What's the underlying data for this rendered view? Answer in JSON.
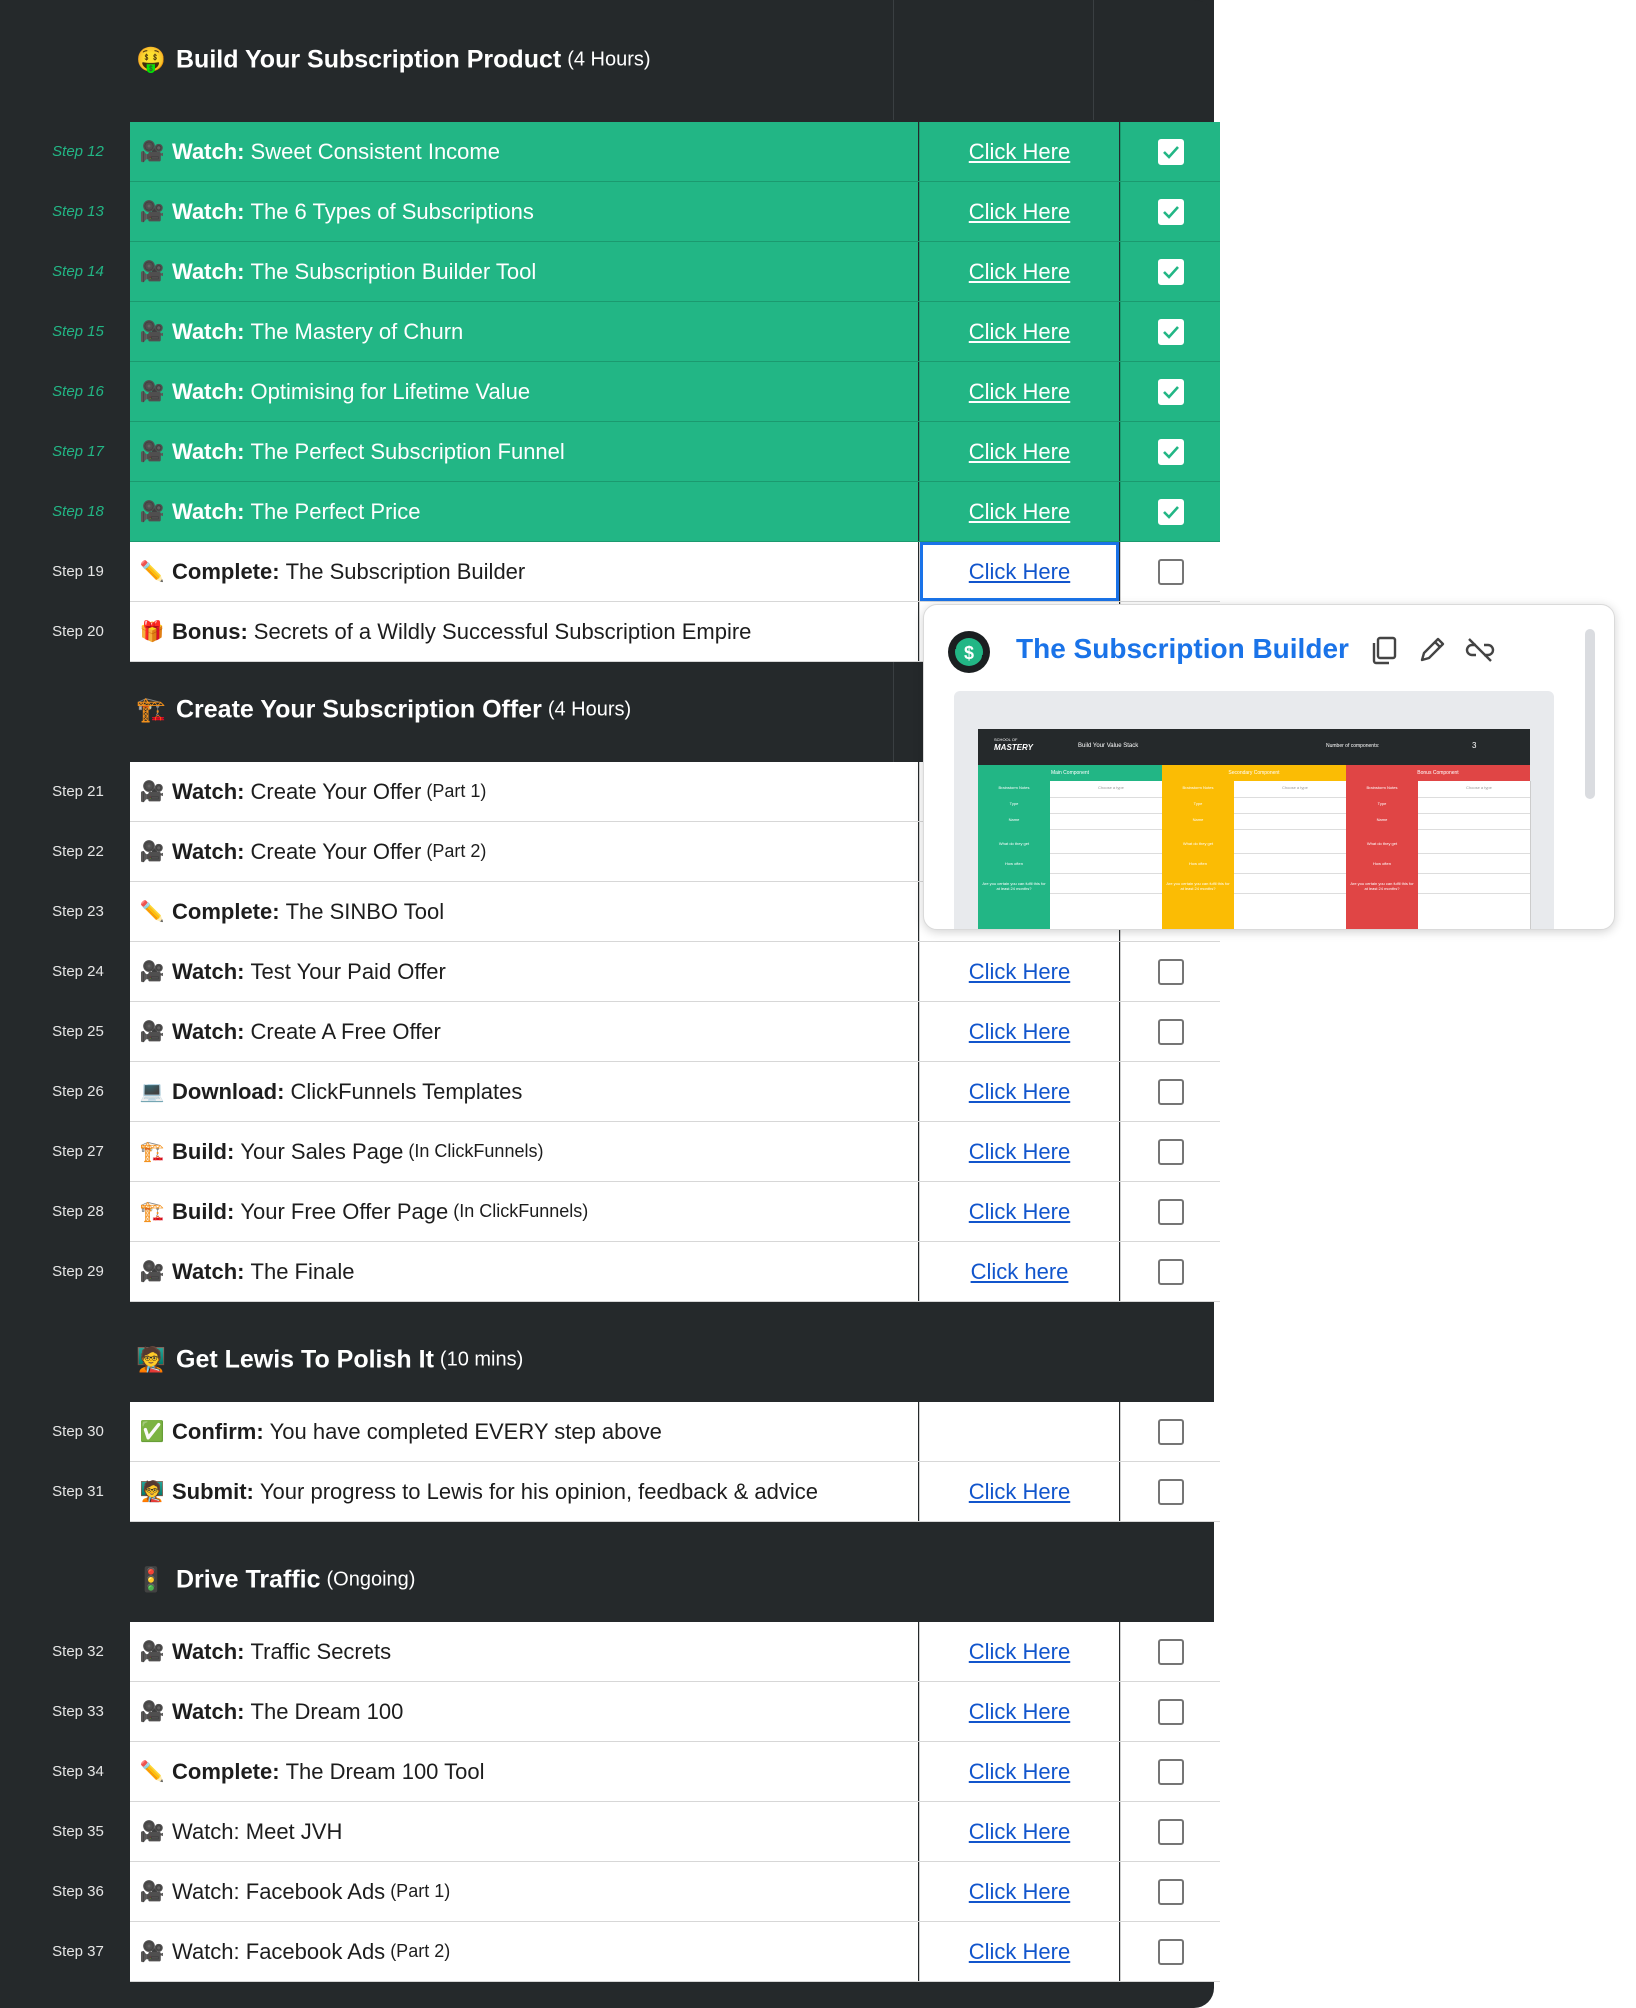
{
  "colors": {
    "dark": "#25292b",
    "done_green": "#22b685",
    "link_blue": "#1155cc",
    "popup_title_blue": "#1a73e8",
    "thumb_green": "#22b685",
    "thumb_yellow": "#fbbc04",
    "thumb_red": "#e04545"
  },
  "sections": [
    {
      "emoji": "🤑",
      "title": "Build Your Subscription Product",
      "sub": "(4 Hours)"
    },
    {
      "emoji": "🏗️",
      "title": "Create Your Subscription Offer",
      "sub": "(4 Hours)"
    },
    {
      "emoji": "🧑‍🏫",
      "title": "Get Lewis To Polish It",
      "sub": "(10 mins)"
    },
    {
      "emoji": "🚦",
      "title": "Drive Traffic",
      "sub": "(Ongoing)"
    }
  ],
  "rows": [
    {
      "step": "Step 12",
      "emoji": "🎥",
      "verb": "Watch:",
      "text": "Sweet Consistent Income",
      "small": "",
      "link": "Click Here",
      "checked": true
    },
    {
      "step": "Step 13",
      "emoji": "🎥",
      "verb": "Watch:",
      "text": "The 6 Types of Subscriptions",
      "small": "",
      "link": "Click Here",
      "checked": true
    },
    {
      "step": "Step 14",
      "emoji": "🎥",
      "verb": "Watch:",
      "text": "The Subscription Builder Tool",
      "small": "",
      "link": "Click Here",
      "checked": true
    },
    {
      "step": "Step 15",
      "emoji": "🎥",
      "verb": "Watch:",
      "text": "The Mastery of Churn",
      "small": "",
      "link": "Click Here",
      "checked": true
    },
    {
      "step": "Step 16",
      "emoji": "🎥",
      "verb": "Watch:",
      "text": "Optimising for Lifetime Value",
      "small": "",
      "link": "Click Here",
      "checked": true
    },
    {
      "step": "Step 17",
      "emoji": "🎥",
      "verb": "Watch:",
      "text": "The Perfect Subscription Funnel",
      "small": "",
      "link": "Click Here",
      "checked": true
    },
    {
      "step": "Step 18",
      "emoji": "🎥",
      "verb": "Watch:",
      "text": "The Perfect Price",
      "small": "",
      "link": "Click Here",
      "checked": true
    },
    {
      "step": "Step 19",
      "emoji": "✏️",
      "verb": "Complete:",
      "text": "The Subscription Builder",
      "small": "",
      "link": "Click Here",
      "checked": false
    },
    {
      "step": "Step 20",
      "emoji": "🎁",
      "verb": "Bonus:",
      "text": "Secrets of a Wildly Successful Subscription Empire",
      "small": "",
      "link": "",
      "checked": false
    },
    {
      "step": "Step 21",
      "emoji": "🎥",
      "verb": "Watch:",
      "text": "Create Your Offer",
      "small": "(Part 1)",
      "link": "",
      "checked": false
    },
    {
      "step": "Step 22",
      "emoji": "🎥",
      "verb": "Watch:",
      "text": "Create Your Offer",
      "small": "(Part 2)",
      "link": "",
      "checked": false
    },
    {
      "step": "Step 23",
      "emoji": "✏️",
      "verb": "Complete:",
      "text": "The SINBO Tool",
      "small": "",
      "link": "",
      "checked": false
    },
    {
      "step": "Step 24",
      "emoji": "🎥",
      "verb": "Watch:",
      "text": "Test Your Paid Offer",
      "small": "",
      "link": "Click Here",
      "checked": false
    },
    {
      "step": "Step 25",
      "emoji": "🎥",
      "verb": "Watch:",
      "text": "Create A Free Offer",
      "small": "",
      "link": "Click Here",
      "checked": false
    },
    {
      "step": "Step 26",
      "emoji": "💻",
      "verb": "Download:",
      "text": "ClickFunnels Templates",
      "small": "",
      "link": "Click Here",
      "checked": false
    },
    {
      "step": "Step 27",
      "emoji": "🏗️",
      "verb": "Build:",
      "text": "Your Sales Page",
      "small": "(In ClickFunnels)",
      "link": "Click Here",
      "checked": false
    },
    {
      "step": "Step 28",
      "emoji": "🏗️",
      "verb": "Build:",
      "text": "Your Free Offer Page",
      "small": "(In ClickFunnels)",
      "link": "Click Here",
      "checked": false
    },
    {
      "step": "Step 29",
      "emoji": "🎥",
      "verb": "Watch:",
      "text": "The Finale",
      "small": "",
      "link": "Click here",
      "checked": false
    },
    {
      "step": "Step 30",
      "emoji": "✅",
      "verb": "Confirm:",
      "text": "You have completed EVERY step above",
      "small": "",
      "link": "",
      "checked": false
    },
    {
      "step": "Step 31",
      "emoji": "🧑‍🏫",
      "verb": "Submit:",
      "text": "Your progress to Lewis for his opinion, feedback & advice",
      "small": "",
      "link": "Click Here",
      "checked": false
    },
    {
      "step": "Step 32",
      "emoji": "🎥",
      "verb": "Watch:",
      "text": "Traffic Secrets",
      "small": "",
      "link": "Click Here",
      "checked": false
    },
    {
      "step": "Step 33",
      "emoji": "🎥",
      "verb": "Watch:",
      "text": "The Dream 100",
      "small": "",
      "link": "Click Here",
      "checked": false
    },
    {
      "step": "Step 34",
      "emoji": "✏️",
      "verb": "Complete:",
      "text": "The Dream 100 Tool",
      "small": "",
      "link": "Click Here",
      "checked": false
    },
    {
      "step": "Step 35",
      "emoji": "🎥",
      "verb": "",
      "text": "Watch: Meet JVH",
      "small": "",
      "link": "Click Here",
      "checked": false
    },
    {
      "step": "Step 36",
      "emoji": "🎥",
      "verb": "",
      "text": "Watch: Facebook Ads",
      "small": "(Part 1)",
      "link": "Click Here",
      "checked": false
    },
    {
      "step": "Step 37",
      "emoji": "🎥",
      "verb": "",
      "text": "Watch: Facebook Ads",
      "small": "(Part 2)",
      "link": "Click Here",
      "checked": false
    }
  ],
  "popup": {
    "title": "The Subscription Builder",
    "icons": [
      "copy-icon",
      "edit-pencil-icon",
      "unlink-icon"
    ],
    "thumb": {
      "brand_top": "SCHOOL OF",
      "brand": "MASTERY",
      "heading": "Build Your Value Stack",
      "components_label": "Number of components:",
      "components_value": "3",
      "columns": [
        "Main Component",
        "Secondary Component",
        "Bonus Component"
      ],
      "row_labels": [
        "Brainstorm Notes",
        "Type",
        "Name",
        "What do they get",
        "How often",
        "Are you certain you can fulfil this for at least 24 months?"
      ],
      "choose": "Choose a type"
    }
  }
}
